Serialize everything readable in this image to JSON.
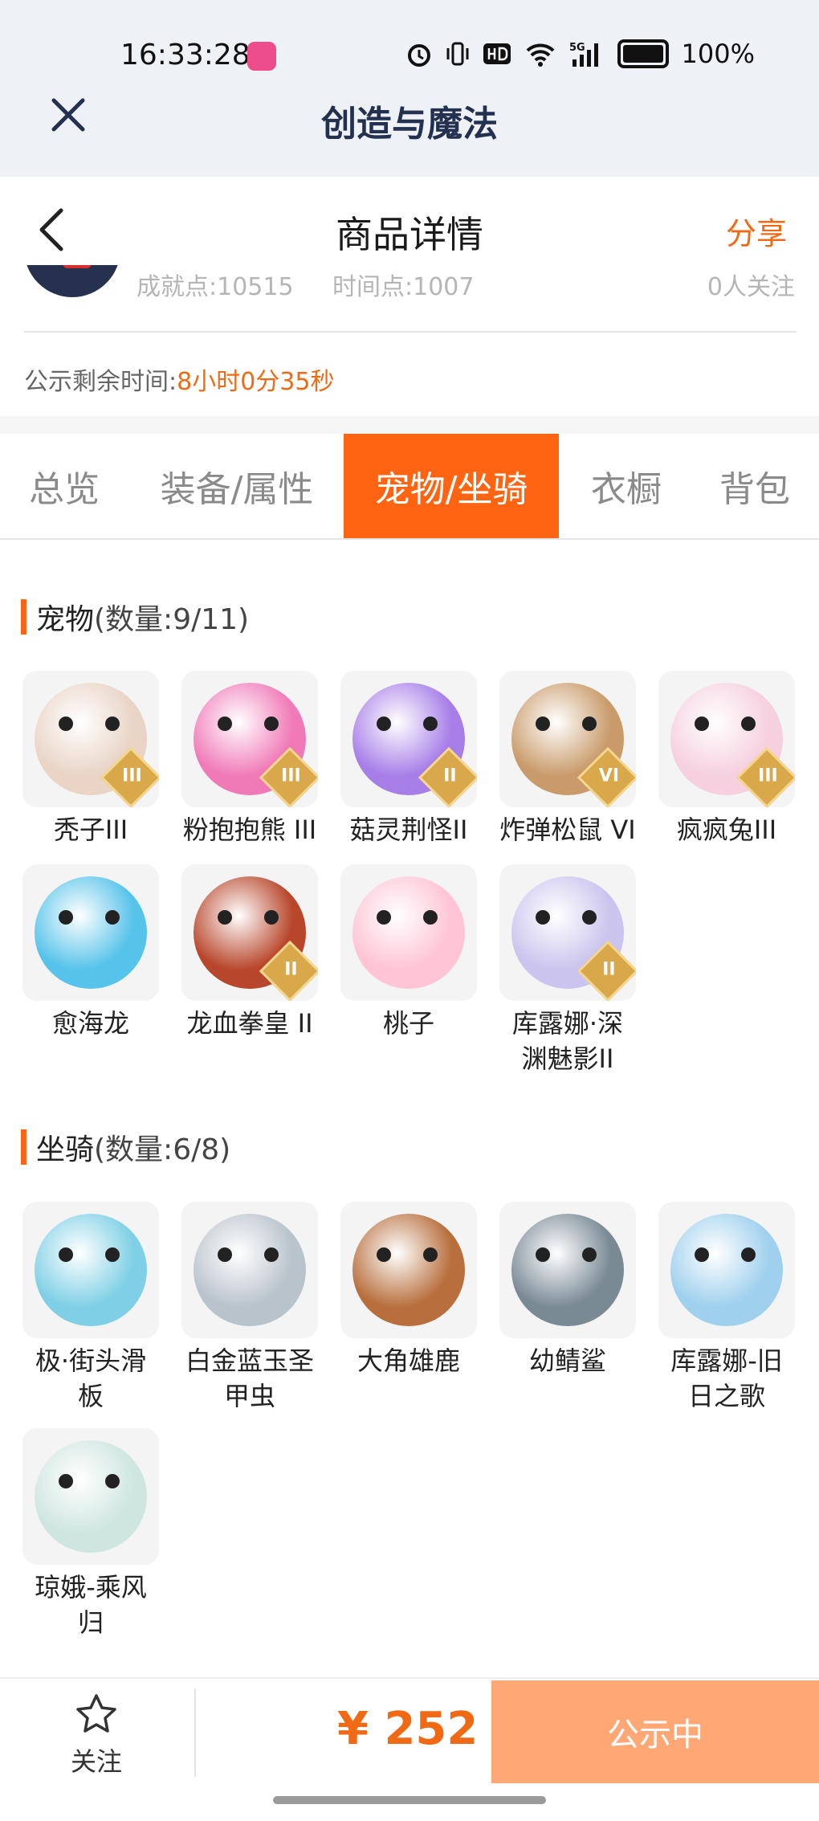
{
  "status_bar": {
    "time": "16:33:28",
    "battery": "100%"
  },
  "app": {
    "title": "创造与魔法"
  },
  "header": {
    "title": "商品详情",
    "share": "分享"
  },
  "profile_row": {
    "achievement": "成就点:10515",
    "time_points": "时间点:1007",
    "followers": "0人关注"
  },
  "notice": {
    "label": "公示剩余时间:",
    "value": "8小时0分35秒"
  },
  "tabs": [
    {
      "label": "总览",
      "active": false
    },
    {
      "label": "装备/属性",
      "active": false
    },
    {
      "label": "宠物/坐骑",
      "active": true
    },
    {
      "label": "衣橱",
      "active": false
    },
    {
      "label": "背包",
      "active": false
    }
  ],
  "pets": {
    "title": "宠物",
    "count": "(数量:9/11)",
    "items": [
      {
        "name": "秃子III",
        "rank": "III",
        "color": "#e9d4c6"
      },
      {
        "name": "粉抱抱熊 III",
        "rank": "III",
        "color": "#f07ab8"
      },
      {
        "name": "菇灵荆怪II",
        "rank": "II",
        "color": "#a77ee8"
      },
      {
        "name": "炸弹松鼠 VI",
        "rank": "VI",
        "color": "#c99b6a"
      },
      {
        "name": "疯疯兔III",
        "rank": "III",
        "color": "#f6d0df"
      },
      {
        "name": "愈海龙",
        "rank": "",
        "color": "#56c3ea"
      },
      {
        "name": "龙血拳皇 II",
        "rank": "II",
        "color": "#b8462b"
      },
      {
        "name": "桃子",
        "rank": "",
        "color": "#ffc4d6"
      },
      {
        "name": "库露娜·深渊魅影II",
        "rank": "II",
        "color": "#cbc4ee"
      }
    ]
  },
  "mounts": {
    "title": "坐骑",
    "count": "(数量:6/8)",
    "items": [
      {
        "name": "极·街头滑板",
        "color": "#7fd0e6"
      },
      {
        "name": "白金蓝玉圣甲虫",
        "color": "#b9c3cc"
      },
      {
        "name": "大角雄鹿",
        "color": "#b86f3d"
      },
      {
        "name": "幼鲭鲨",
        "color": "#7a8a95"
      },
      {
        "name": "库露娜-旧日之歌",
        "color": "#9fd0ee"
      },
      {
        "name": "琼娥-乘风归",
        "color": "#cfe6e0"
      }
    ]
  },
  "bottom": {
    "follow": "关注",
    "price": "¥ 252",
    "status_button": "公示中"
  }
}
